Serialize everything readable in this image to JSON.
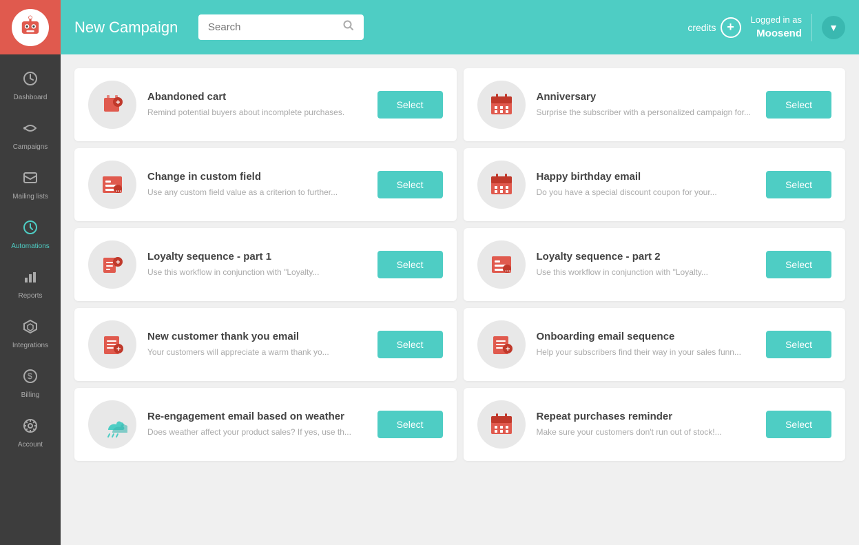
{
  "topbar": {
    "title": "New Campaign",
    "search_placeholder": "Search",
    "credits_label": "credits",
    "logged_in_label": "Logged in as",
    "logged_in_user": "Moosend"
  },
  "sidebar": {
    "items": [
      {
        "id": "dashboard",
        "label": "Dashboard",
        "icon": "⏱"
      },
      {
        "id": "campaigns",
        "label": "Campaigns",
        "icon": "📢"
      },
      {
        "id": "mailing-lists",
        "label": "Mailing lists",
        "icon": "✉"
      },
      {
        "id": "automations",
        "label": "Automations",
        "icon": "⏰",
        "active": true
      },
      {
        "id": "reports",
        "label": "Reports",
        "icon": "📊"
      },
      {
        "id": "integrations",
        "label": "Integrations",
        "icon": "◈"
      },
      {
        "id": "billing",
        "label": "Billing",
        "icon": "$"
      },
      {
        "id": "account",
        "label": "Account",
        "icon": "⚙"
      }
    ]
  },
  "cards": [
    {
      "id": "abandoned-cart",
      "title": "Abandoned cart",
      "desc": "Remind potential buyers about incomplete purchases.",
      "icon_type": "cart",
      "select_label": "Select"
    },
    {
      "id": "anniversary",
      "title": "Anniversary",
      "desc": "Surprise the subscriber with a personalized campaign for...",
      "icon_type": "calendar",
      "select_label": "Select"
    },
    {
      "id": "change-custom-field",
      "title": "Change in custom field",
      "desc": "Use any custom field value as a criterion to further...",
      "icon_type": "field",
      "select_label": "Select"
    },
    {
      "id": "happy-birthday",
      "title": "Happy birthday email",
      "desc": "Do you have a special discount coupon for your...",
      "icon_type": "calendar",
      "select_label": "Select"
    },
    {
      "id": "loyalty-part1",
      "title": "Loyalty sequence - part 1",
      "desc": "Use this workflow in conjunction with \"Loyalty...",
      "icon_type": "loyalty1",
      "select_label": "Select"
    },
    {
      "id": "loyalty-part2",
      "title": "Loyalty sequence - part 2",
      "desc": "Use this workflow in conjunction with \"Loyalty...",
      "icon_type": "field",
      "select_label": "Select"
    },
    {
      "id": "new-customer-thankyou",
      "title": "New customer thank you email",
      "desc": "Your customers will appreciate a warm thank yo...",
      "icon_type": "onboard",
      "select_label": "Select"
    },
    {
      "id": "onboarding",
      "title": "Onboarding email sequence",
      "desc": "Help your subscribers find their way in your sales funn...",
      "icon_type": "onboard2",
      "select_label": "Select"
    },
    {
      "id": "reengagement-weather",
      "title": "Re-engagement email based on weather",
      "desc": "Does weather affect your product sales? If yes, use th...",
      "icon_type": "weather",
      "select_label": "Select"
    },
    {
      "id": "repeat-purchases",
      "title": "Repeat purchases reminder",
      "desc": "Make sure your customers don't run out of stock!...",
      "icon_type": "calendar",
      "select_label": "Select"
    }
  ]
}
